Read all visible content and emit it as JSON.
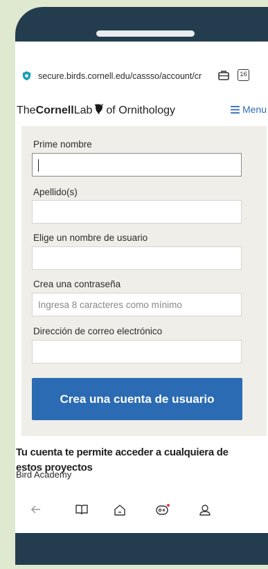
{
  "browser": {
    "url": "secure.birds.cornell.edu/cassso/account/cr",
    "tab_count": "16"
  },
  "header": {
    "logo_the": "The",
    "logo_cornell": "Cornell",
    "logo_lab": "Lab",
    "logo_of": "of Ornithology",
    "menu_label": "Menu"
  },
  "form": {
    "first_name_label": "Prime nombre",
    "last_name_label": "Apellido(s)",
    "username_label": "Elige un nombre de usuario",
    "password_label": "Crea una contraseña",
    "password_placeholder": "Ingresa 8 caracteres como mínimo",
    "email_label": "Dirección de correo electrónico",
    "submit_label": "Crea una cuenta de usuario"
  },
  "content": {
    "info_text": "Tu cuenta te permite acceder a cualquiera de estos proyectos",
    "first_project": "Bird Academy"
  },
  "colors": {
    "accent": "#2b6bb3",
    "phone_frame": "#233d4f",
    "background": "#dfe9d0",
    "form_panel": "#f0eee9"
  }
}
